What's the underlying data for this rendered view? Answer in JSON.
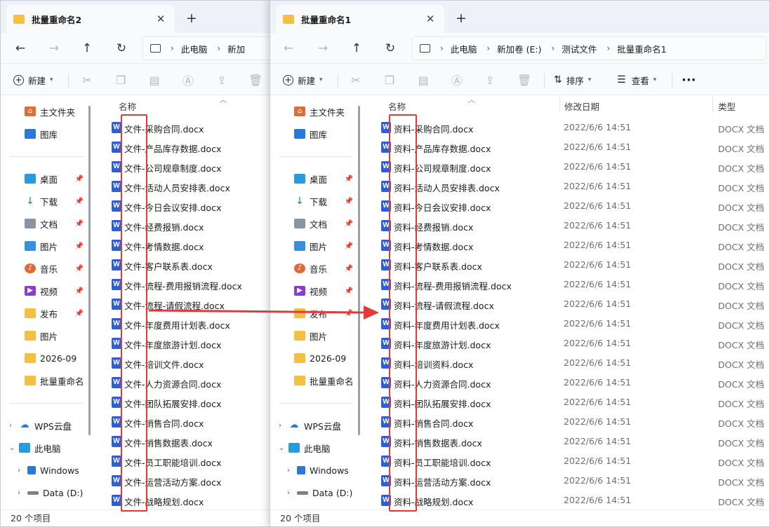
{
  "windows": [
    {
      "tab_title": "批量重命名2",
      "breadcrumb": [
        "此电脑",
        "新加"
      ],
      "toolbar_new": "新建",
      "column_name": "名称",
      "files": [
        "文件-采购合同.docx",
        "文件-产品库存数据.docx",
        "文件-公司规章制度.docx",
        "文件-活动人员安排表.docx",
        "文件-今日会议安排.docx",
        "文件-经费报销.docx",
        "文件-考情数据.docx",
        "文件-客户联系表.docx",
        "文件-流程-费用报销流程.docx",
        "文件-流程-请假流程.docx",
        "文件-年度费用计划表.docx",
        "文件-年度旅游计划.docx",
        "文件-培训文件.docx",
        "文件-人力资源合同.docx",
        "文件-团队拓展安排.docx",
        "文件-销售合同.docx",
        "文件-销售数据表.docx",
        "文件-员工职能培训.docx",
        "文件-运营活动方案.docx",
        "文件-战略规划.docx"
      ],
      "status": "20 个项目"
    },
    {
      "tab_title": "批量重命名1",
      "breadcrumb": [
        "此电脑",
        "新加卷 (E:)",
        "测试文件",
        "批量重命名1"
      ],
      "toolbar_new": "新建",
      "toolbar_sort": "排序",
      "toolbar_view": "查看",
      "column_name": "名称",
      "column_date": "修改日期",
      "column_type": "类型",
      "files": [
        "资料-采购合同.docx",
        "资料-产品库存数据.docx",
        "资料-公司规章制度.docx",
        "资料-活动人员安排表.docx",
        "资料-今日会议安排.docx",
        "资料-经费报销.docx",
        "资料-考情数据.docx",
        "资料-客户联系表.docx",
        "资料-流程-费用报销流程.docx",
        "资料-流程-请假流程.docx",
        "资料-年度费用计划表.docx",
        "资料-年度旅游计划.docx",
        "资料-培训资料.docx",
        "资料-人力资源合同.docx",
        "资料-团队拓展安排.docx",
        "资料-销售合同.docx",
        "资料-销售数据表.docx",
        "资料-员工职能培训.docx",
        "资料-运营活动方案.docx",
        "资料-战略规划.docx"
      ],
      "file_date": "2022/6/6 14:51",
      "file_type": "DOCX 文档",
      "status": "20 个项目"
    }
  ],
  "sidebar": {
    "home": "主文件夹",
    "gallery": "图库",
    "desktop": "桌面",
    "downloads": "下载",
    "documents": "文档",
    "pictures": "图片",
    "music": "音乐",
    "videos": "视频",
    "publish": "发布",
    "pictures2": "图片",
    "folder_2026": "2026-09",
    "rename_folder": "批量重命名",
    "wps_cloud": "WPS云盘",
    "this_pc": "此电脑",
    "windows_drive": "Windows",
    "data_drive": "Data (D:)"
  },
  "colors": {
    "highlight_red": "#e03a3a",
    "word_blue": "#2b5ed8",
    "folder_yellow": "#f4c03f"
  },
  "icons": [
    "folder-icon",
    "close-icon",
    "plus-icon",
    "back-icon",
    "forward-icon",
    "up-icon",
    "refresh-icon",
    "computer-icon",
    "new-icon",
    "cut-icon",
    "copy-icon",
    "paste-icon",
    "rename-icon",
    "share-icon",
    "delete-icon",
    "sort-icon",
    "view-icon",
    "more-icon",
    "home-icon",
    "word-doc-icon",
    "pin-icon",
    "chevron-icon",
    "cloud-icon"
  ]
}
